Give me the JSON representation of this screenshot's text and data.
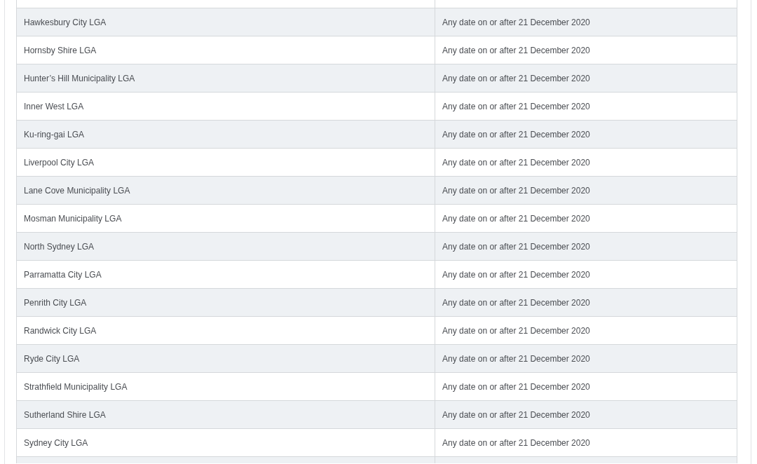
{
  "table": {
    "rows": [
      {
        "area": "Hawkesbury City LGA",
        "date": "Any date on or after 21 December 2020"
      },
      {
        "area": "Hornsby Shire LGA",
        "date": "Any date on or after 21 December 2020"
      },
      {
        "area": "Hunter’s Hill Municipality LGA",
        "date": "Any date on or after 21 December 2020"
      },
      {
        "area": "Inner West LGA",
        "date": "Any date on or after 21 December 2020"
      },
      {
        "area": "Ku-ring-gai LGA",
        "date": "Any date on or after 21 December 2020"
      },
      {
        "area": "Liverpool City LGA",
        "date": "Any date on or after 21 December 2020"
      },
      {
        "area": "Lane Cove Municipality LGA",
        "date": "Any date on or after 21 December 2020"
      },
      {
        "area": "Mosman Municipality LGA",
        "date": "Any date on or after 21 December 2020"
      },
      {
        "area": "North Sydney LGA",
        "date": "Any date on or after 21 December 2020"
      },
      {
        "area": "Parramatta City LGA",
        "date": "Any date on or after 21 December 2020"
      },
      {
        "area": "Penrith City LGA",
        "date": "Any date on or after 21 December 2020"
      },
      {
        "area": "Randwick City LGA",
        "date": "Any date on or after 21 December 2020"
      },
      {
        "area": "Ryde City LGA",
        "date": "Any date on or after 21 December 2020"
      },
      {
        "area": "Strathfield Municipality LGA",
        "date": "Any date on or after 21 December 2020"
      },
      {
        "area": "Sutherland Shire LGA",
        "date": "Any date on or after 21 December 2020"
      },
      {
        "area": "Sydney City LGA",
        "date": "Any date on or after 21 December 2020"
      }
    ]
  }
}
